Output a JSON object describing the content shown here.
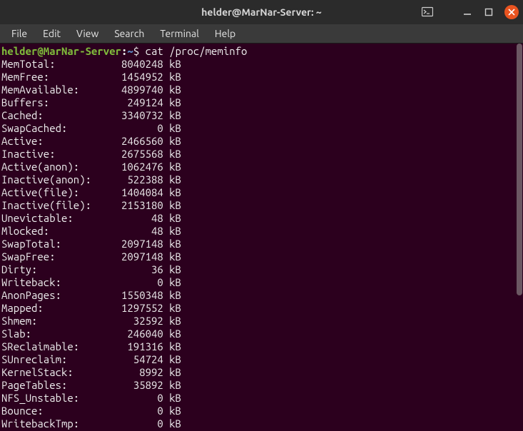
{
  "window": {
    "title": "helder@MarNar-Server: ~"
  },
  "menu": {
    "file": "File",
    "edit": "Edit",
    "view": "View",
    "search": "Search",
    "terminal": "Terminal",
    "help": "Help"
  },
  "prompt": {
    "userhost": "helder@MarNar-Server",
    "colon": ":",
    "path": "~",
    "dollar": "$"
  },
  "command": "cat /proc/meminfo",
  "rows": [
    {
      "label": "MemTotal:",
      "value": "8040248",
      "unit": "kB"
    },
    {
      "label": "MemFree:",
      "value": "1454952",
      "unit": "kB"
    },
    {
      "label": "MemAvailable:",
      "value": "4899740",
      "unit": "kB"
    },
    {
      "label": "Buffers:",
      "value": "249124",
      "unit": "kB"
    },
    {
      "label": "Cached:",
      "value": "3340732",
      "unit": "kB"
    },
    {
      "label": "SwapCached:",
      "value": "0",
      "unit": "kB"
    },
    {
      "label": "Active:",
      "value": "2466560",
      "unit": "kB"
    },
    {
      "label": "Inactive:",
      "value": "2675568",
      "unit": "kB"
    },
    {
      "label": "Active(anon):",
      "value": "1062476",
      "unit": "kB"
    },
    {
      "label": "Inactive(anon):",
      "value": "522388",
      "unit": "kB"
    },
    {
      "label": "Active(file):",
      "value": "1404084",
      "unit": "kB"
    },
    {
      "label": "Inactive(file):",
      "value": "2153180",
      "unit": "kB"
    },
    {
      "label": "Unevictable:",
      "value": "48",
      "unit": "kB"
    },
    {
      "label": "Mlocked:",
      "value": "48",
      "unit": "kB"
    },
    {
      "label": "SwapTotal:",
      "value": "2097148",
      "unit": "kB"
    },
    {
      "label": "SwapFree:",
      "value": "2097148",
      "unit": "kB"
    },
    {
      "label": "Dirty:",
      "value": "36",
      "unit": "kB"
    },
    {
      "label": "Writeback:",
      "value": "0",
      "unit": "kB"
    },
    {
      "label": "AnonPages:",
      "value": "1550348",
      "unit": "kB"
    },
    {
      "label": "Mapped:",
      "value": "1297552",
      "unit": "kB"
    },
    {
      "label": "Shmem:",
      "value": "32592",
      "unit": "kB"
    },
    {
      "label": "Slab:",
      "value": "246040",
      "unit": "kB"
    },
    {
      "label": "SReclaimable:",
      "value": "191316",
      "unit": "kB"
    },
    {
      "label": "SUnreclaim:",
      "value": "54724",
      "unit": "kB"
    },
    {
      "label": "KernelStack:",
      "value": "8992",
      "unit": "kB"
    },
    {
      "label": "PageTables:",
      "value": "35892",
      "unit": "kB"
    },
    {
      "label": "NFS_Unstable:",
      "value": "0",
      "unit": "kB"
    },
    {
      "label": "Bounce:",
      "value": "0",
      "unit": "kB"
    },
    {
      "label": "WritebackTmp:",
      "value": "0",
      "unit": "kB"
    }
  ]
}
